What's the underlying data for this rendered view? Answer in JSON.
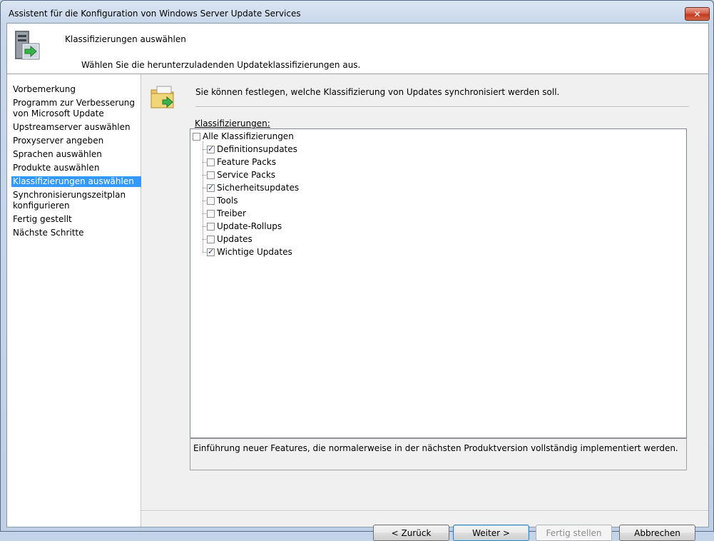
{
  "window": {
    "title": "Assistent für die Konfiguration von Windows Server Update Services",
    "close_label": "✕"
  },
  "header": {
    "title": "Klassifizierungen auswählen",
    "subtitle": "Wählen Sie die herunterzuladenden Updateklassifizierungen aus."
  },
  "nav": {
    "items": [
      {
        "label": "Vorbemerkung"
      },
      {
        "label": "Programm zur Verbesserung von Microsoft Update"
      },
      {
        "label": "Upstreamserver auswählen"
      },
      {
        "label": "Proxyserver angeben"
      },
      {
        "label": "Sprachen auswählen"
      },
      {
        "label": "Produkte auswählen"
      },
      {
        "label": "Klassifizierungen auswählen",
        "selected": true
      },
      {
        "label": "Synchronisierungszeitplan konfigurieren"
      },
      {
        "label": "Fertig gestellt"
      },
      {
        "label": "Nächste Schritte"
      }
    ]
  },
  "main": {
    "description": "Sie können festlegen, welche Klassifizierung von Updates synchronisiert werden soll.",
    "list_label": "Klassifizierungen:",
    "root": {
      "label": "Alle Klassifizierungen",
      "checked": false
    },
    "classifications": [
      {
        "label": "Definitionsupdates",
        "checked": true
      },
      {
        "label": "Feature Packs",
        "checked": false
      },
      {
        "label": "Service Packs",
        "checked": false
      },
      {
        "label": "Sicherheitsupdates",
        "checked": true
      },
      {
        "label": "Tools",
        "checked": false
      },
      {
        "label": "Treiber",
        "checked": false
      },
      {
        "label": "Update-Rollups",
        "checked": false
      },
      {
        "label": "Updates",
        "checked": false
      },
      {
        "label": "Wichtige Updates",
        "checked": true
      }
    ],
    "detail_text": "Einführung neuer Features, die normalerweise in der nächsten Produktversion vollständig implementiert werden."
  },
  "buttons": {
    "back": "< Zurück",
    "next": "Weiter >",
    "finish": "Fertig stellen",
    "cancel": "Abbrechen"
  }
}
